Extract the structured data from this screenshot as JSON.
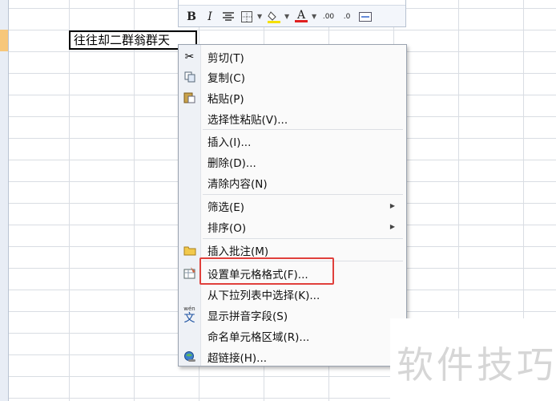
{
  "sheet": {
    "active_cell_text": "往往却二群翁群天"
  },
  "mini_toolbar": {
    "bold": "B",
    "italic": "I",
    "font_color_letter": "A",
    "fill_color": "#f5e000",
    "font_color": "#e02020",
    "increase_decimal": ".00",
    "decrease_decimal": ".0"
  },
  "menu": {
    "items": [
      {
        "label": "剪切(T)",
        "icon": "scissors-icon"
      },
      {
        "label": "复制(C)",
        "icon": "copy-icon"
      },
      {
        "label": "粘贴(P)",
        "icon": "paste-icon"
      },
      {
        "label": "选择性粘贴(V)..."
      },
      {
        "label": "插入(I)..."
      },
      {
        "label": "删除(D)..."
      },
      {
        "label": "清除内容(N)"
      },
      {
        "label": "筛选(E)",
        "submenu": true
      },
      {
        "label": "排序(O)",
        "submenu": true
      },
      {
        "label": "插入批注(M)",
        "icon": "comment-folder-icon"
      },
      {
        "label": "设置单元格格式(F)...",
        "icon": "format-cells-icon",
        "highlighted": true
      },
      {
        "label": "从下拉列表中选择(K)..."
      },
      {
        "label": "显示拼音字段(S)",
        "icon": "phonetic-icon"
      },
      {
        "label": "命名单元格区域(R)..."
      },
      {
        "label": "超链接(H)...",
        "icon": "hyperlink-icon"
      }
    ]
  },
  "watermark": "软件技巧"
}
